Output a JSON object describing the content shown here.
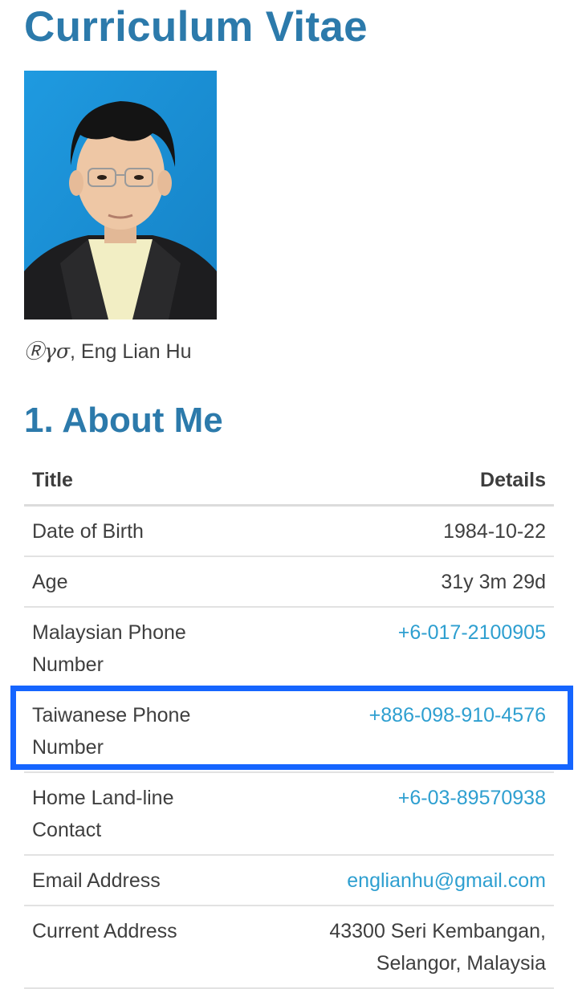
{
  "page": {
    "title": "Curriculum Vitae"
  },
  "profile": {
    "photo_alt": "Eng Lian Hu",
    "caption_symbol": "Ⓡγσ",
    "caption_name": ", Eng Lian Hu"
  },
  "about": {
    "heading": "1. About Me",
    "columns": [
      "Title",
      "Details"
    ],
    "rows": [
      {
        "label": "Date of Birth",
        "value": "1984-10-22"
      },
      {
        "label": "Age",
        "value": "31y 3m 29d"
      },
      {
        "label": "Malaysian Phone Number",
        "value": "+6-017-2100905"
      },
      {
        "label": "Taiwanese Phone Number",
        "value": "+886-098-910-4576"
      },
      {
        "label": "Home Land-line Contact",
        "value": "+6-03-89570938"
      },
      {
        "label": "Email Address",
        "value": "englianhu@gmail.com"
      },
      {
        "label": "Current Address",
        "value": "43300 Seri Kembangan, Selangor, Malaysia"
      }
    ]
  },
  "colors": {
    "heading": "#2c7aab",
    "link": "#2e9fd0",
    "highlight": "#1565ff",
    "photo_background": "#1a8fd4"
  }
}
